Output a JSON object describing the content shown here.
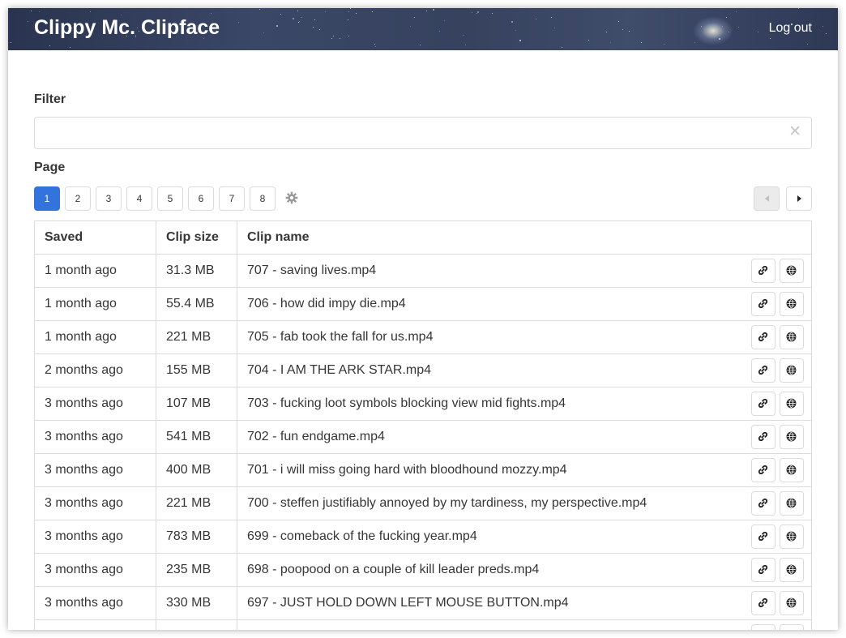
{
  "app": {
    "title": "Clippy Mc. Clipface",
    "logout_label": "Log out"
  },
  "filter": {
    "label": "Filter",
    "value": "",
    "placeholder": "",
    "clear_icon": "close-icon"
  },
  "pagination": {
    "label": "Page",
    "pages": [
      "1",
      "2",
      "3",
      "4",
      "5",
      "6",
      "7",
      "8"
    ],
    "active_page": "1",
    "settings_icon": "gear-icon",
    "prev_icon": "chevron-left-icon",
    "next_icon": "chevron-right-icon"
  },
  "table": {
    "columns": [
      "Saved",
      "Clip size",
      "Clip name"
    ],
    "row_actions": [
      "link-icon",
      "globe-icon"
    ],
    "rows": [
      {
        "saved": "1 month ago",
        "size": "31.3 MB",
        "name": "707 - saving lives.mp4"
      },
      {
        "saved": "1 month ago",
        "size": "55.4 MB",
        "name": "706 - how did impy die.mp4"
      },
      {
        "saved": "1 month ago",
        "size": "221 MB",
        "name": "705 - fab took the fall for us.mp4"
      },
      {
        "saved": "2 months ago",
        "size": "155 MB",
        "name": "704 - I AM THE ARK STAR.mp4"
      },
      {
        "saved": "3 months ago",
        "size": "107 MB",
        "name": "703 - fucking loot symbols blocking view mid fights.mp4"
      },
      {
        "saved": "3 months ago",
        "size": "541 MB",
        "name": "702 - fun endgame.mp4"
      },
      {
        "saved": "3 months ago",
        "size": "400 MB",
        "name": "701 - i will miss going hard with bloodhound mozzy.mp4"
      },
      {
        "saved": "3 months ago",
        "size": "221 MB",
        "name": "700 - steffen justifiably annoyed by my tardiness, my perspective.mp4"
      },
      {
        "saved": "3 months ago",
        "size": "783 MB",
        "name": "699 - comeback of the fucking year.mp4"
      },
      {
        "saved": "3 months ago",
        "size": "235 MB",
        "name": "698 - poopood on a couple of kill leader preds.mp4"
      },
      {
        "saved": "3 months ago",
        "size": "330 MB",
        "name": "697 - JUST HOLD DOWN LEFT MOUSE BUTTON.mp4"
      },
      {
        "saved": "",
        "size": "",
        "name": ""
      }
    ]
  },
  "colors": {
    "accent": "#3273dc",
    "border": "#dbdbdb",
    "text": "#363636",
    "navbar": "#36425e"
  }
}
